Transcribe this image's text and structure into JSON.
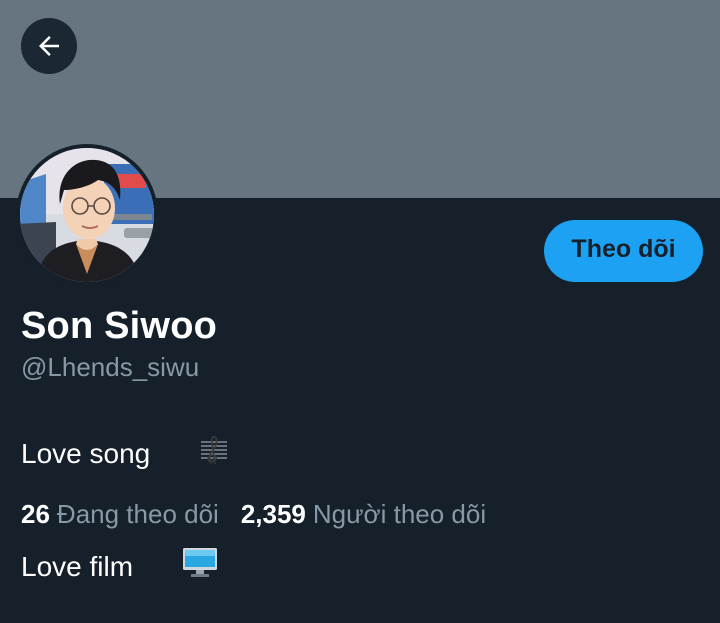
{
  "profile": {
    "name": "Son Siwoo",
    "handle": "@Lhends_siwu",
    "bio": [
      "Love song",
      "Love film"
    ],
    "bio_emoji": [
      "musical-score-icon",
      "desktop-computer-icon"
    ]
  },
  "follow_button": {
    "label": "Theo dõi"
  },
  "stats": {
    "following_count": "26",
    "following_label": "Đang theo dõi",
    "followers_count": "2,359",
    "followers_label": "Người theo dõi"
  },
  "colors": {
    "banner": "#66757f",
    "background": "#15202b",
    "accent": "#1da1f2",
    "secondary_text": "#8899a6"
  }
}
